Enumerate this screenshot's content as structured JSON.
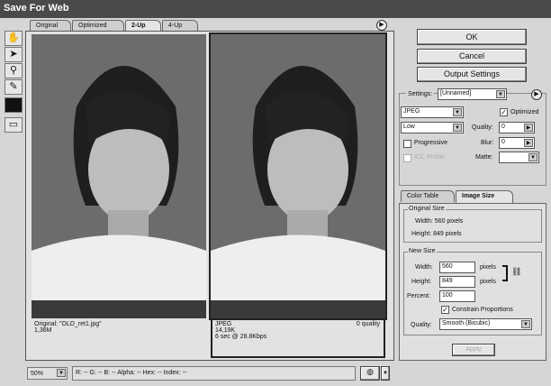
{
  "window": {
    "title": "Save For Web"
  },
  "tabs": [
    "Original",
    "Optimized",
    "2-Up",
    "4-Up"
  ],
  "active_tab": "2-Up",
  "tools": [
    "hand-icon",
    "slice-select-icon",
    "zoom-icon",
    "eyedropper-icon",
    "color-swatch",
    "toggle-slices-icon"
  ],
  "panes": [
    {
      "line1": "Original: \"OLD_ret1.jpg\"",
      "line2": "1,36M",
      "line3": "",
      "right": ""
    },
    {
      "line1": "JPEG",
      "line2": "14,19K",
      "line3": "6 sec @ 28.8Kbps",
      "right": "0 quality"
    }
  ],
  "buttons": {
    "ok": "OK",
    "cancel": "Cancel",
    "output": "Output Settings",
    "apply": "Apply"
  },
  "settings": {
    "label": "Settings:",
    "value": "[Unnamed]",
    "format": "JPEG",
    "quality_preset": "Low",
    "optimized_label": "Optimized",
    "optimized": true,
    "quality_label": "Quality:",
    "quality": "0",
    "progressive_label": "Progressive",
    "progressive": false,
    "icc_label": "ICC Profile",
    "icc": false,
    "blur_label": "Blur:",
    "blur": "0",
    "matte_label": "Matte:",
    "matte": ""
  },
  "panel_tabs": [
    "Color Table",
    "Image Size"
  ],
  "image_size": {
    "original_title": "Original Size",
    "orig_width": "Width: 560 pixels",
    "orig_height": "Height: 849 pixels",
    "new_title": "New Size",
    "width_label": "Width:",
    "width": "560",
    "height_label": "Height:",
    "height": "849",
    "unit": "pixels",
    "percent_label": "Percent:",
    "percent": "100",
    "constrain_label": "Constrain Proportions",
    "constrain": true,
    "quality_label": "Quality:",
    "quality": "Smooth (Bicubic)"
  },
  "status": {
    "zoom": "50%",
    "readout": "R: -- G: -- B: -- Alpha: -- Hex: -- Index: --"
  }
}
